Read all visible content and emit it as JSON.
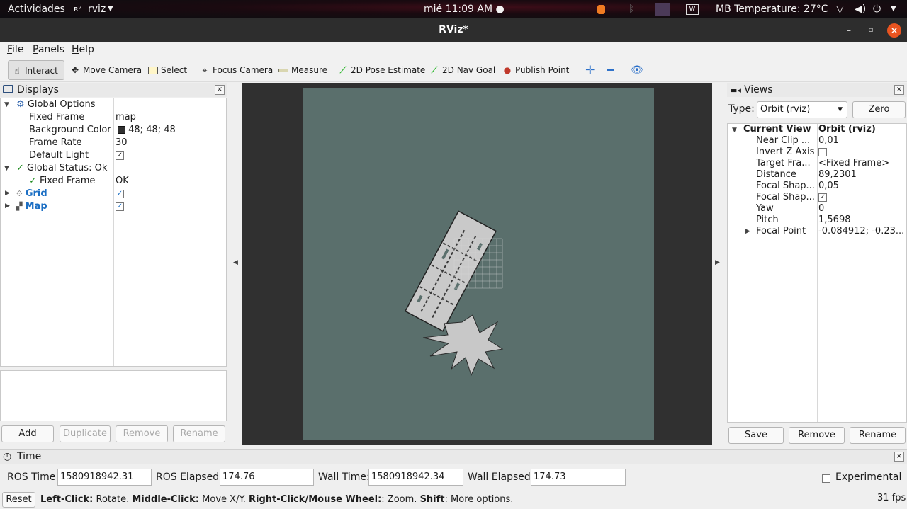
{
  "topbar": {
    "activities": "Actividades",
    "app_name": "rviz",
    "clock": "mié 11:09 AM",
    "temperature": "MB Temperature: 27°C"
  },
  "window": {
    "title": "RViz*"
  },
  "menu": {
    "file": "File",
    "panels": "Panels",
    "help": "Help"
  },
  "toolbar": {
    "interact": "Interact",
    "move_camera": "Move Camera",
    "select": "Select",
    "focus_camera": "Focus Camera",
    "measure": "Measure",
    "pose_estimate": "2D Pose Estimate",
    "nav_goal": "2D Nav Goal",
    "publish_point": "Publish Point"
  },
  "displays": {
    "title": "Displays",
    "global_options": "Global Options",
    "fixed_frame_label": "Fixed Frame",
    "fixed_frame_value": "map",
    "bg_color_label": "Background Color",
    "bg_color_value": "48; 48; 48",
    "bg_color_hex": "#303030",
    "frame_rate_label": "Frame Rate",
    "frame_rate_value": "30",
    "default_light_label": "Default Light",
    "global_status": "Global Status: Ok",
    "status_fixed_frame_label": "Fixed Frame",
    "status_fixed_frame_value": "OK",
    "grid": "Grid",
    "map": "Map",
    "buttons": {
      "add": "Add",
      "duplicate": "Duplicate",
      "remove": "Remove",
      "rename": "Rename"
    }
  },
  "views": {
    "title": "Views",
    "type_label": "Type:",
    "type_value": "Orbit (rviz)",
    "zero": "Zero",
    "current_view": "Current View",
    "current_view_value": "Orbit (rviz)",
    "props": [
      {
        "label": "Near Clip ...",
        "value": "0,01"
      },
      {
        "label": "Invert Z Axis",
        "value": ""
      },
      {
        "label": "Target Fra...",
        "value": "<Fixed Frame>"
      },
      {
        "label": "Distance",
        "value": "89,2301"
      },
      {
        "label": "Focal Shap...",
        "value": "0,05"
      },
      {
        "label": "Focal Shap...",
        "value": ""
      },
      {
        "label": "Yaw",
        "value": "0"
      },
      {
        "label": "Pitch",
        "value": "1,5698"
      },
      {
        "label": "Focal Point",
        "value": "-0.084912; -0.23..."
      }
    ],
    "buttons": {
      "save": "Save",
      "remove": "Remove",
      "rename": "Rename"
    }
  },
  "time": {
    "title": "Time",
    "ros_time_label": "ROS Time:",
    "ros_time": "1580918942.31",
    "ros_elapsed_label": "ROS Elapsed:",
    "ros_elapsed": "174.76",
    "wall_time_label": "Wall Time:",
    "wall_time": "1580918942.34",
    "wall_elapsed_label": "Wall Elapsed:",
    "wall_elapsed": "174.73",
    "experimental": "Experimental"
  },
  "status": {
    "reset": "Reset",
    "left_click": "Left-Click:",
    "left_click_desc": " Rotate. ",
    "middle_click": "Middle-Click:",
    "middle_click_desc": " Move X/Y. ",
    "right_click": "Right-Click/Mouse Wheel:",
    "right_click_desc": ": Zoom. ",
    "shift": "Shift",
    "shift_desc": ": More options.",
    "fps": "31 fps"
  },
  "colors": {
    "accent_orange": "#e95420",
    "link_blue": "#1c6fc4",
    "map_bg": "#5a6f6c"
  }
}
